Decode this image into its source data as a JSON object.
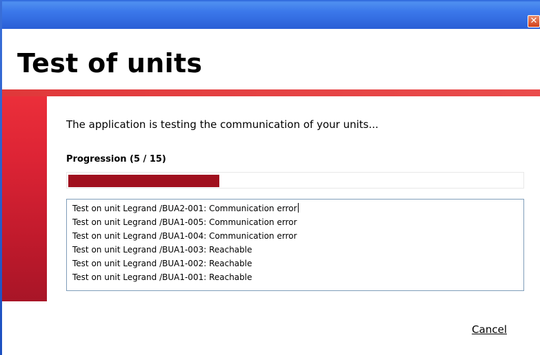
{
  "window": {
    "close_symbol": "✕",
    "accent_color": "#a0101e",
    "titlebar_color": "#2a5fd6"
  },
  "header": {
    "title": "Test of units"
  },
  "main": {
    "description": "The application is testing the communication of your units...",
    "progress": {
      "label": "Progression (5 / 15)",
      "current": 5,
      "total": 15
    },
    "log": [
      "Test on unit Legrand /BUA2-001: Communication error",
      "Test on unit Legrand /BUA1-005: Communication error",
      "Test on unit Legrand /BUA1-004: Communication error",
      "Test on unit Legrand /BUA1-003: Reachable",
      "Test on unit Legrand /BUA1-002: Reachable",
      "Test on unit Legrand /BUA1-001: Reachable"
    ]
  },
  "footer": {
    "cancel_label": "Cancel"
  }
}
